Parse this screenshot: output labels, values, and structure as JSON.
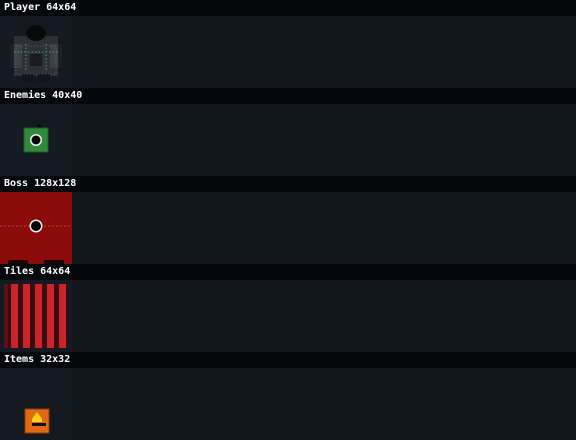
{
  "sections": [
    {
      "title": "Player 64x64"
    },
    {
      "title": "Enemies 40x40"
    },
    {
      "title": "Boss 128x128"
    },
    {
      "title": "Tiles 64x64"
    },
    {
      "title": "Items 32x32"
    }
  ],
  "colors": {
    "background": "#12161d",
    "header": "#06080b",
    "player_body": "#2e3035",
    "player_guide": "#4a9a9a",
    "enemy_body": "#2f8a3c",
    "boss_body": "#8c0c0c",
    "tile_stripe": "#c8262a",
    "item_body": "#e06a14",
    "item_glyph": "#ffd21a"
  },
  "sprites": {
    "player": "player-sprite",
    "enemy": "enemy-sprite",
    "boss": "boss-sprite",
    "tile": "tile-sprite",
    "item": "item-sprite"
  }
}
